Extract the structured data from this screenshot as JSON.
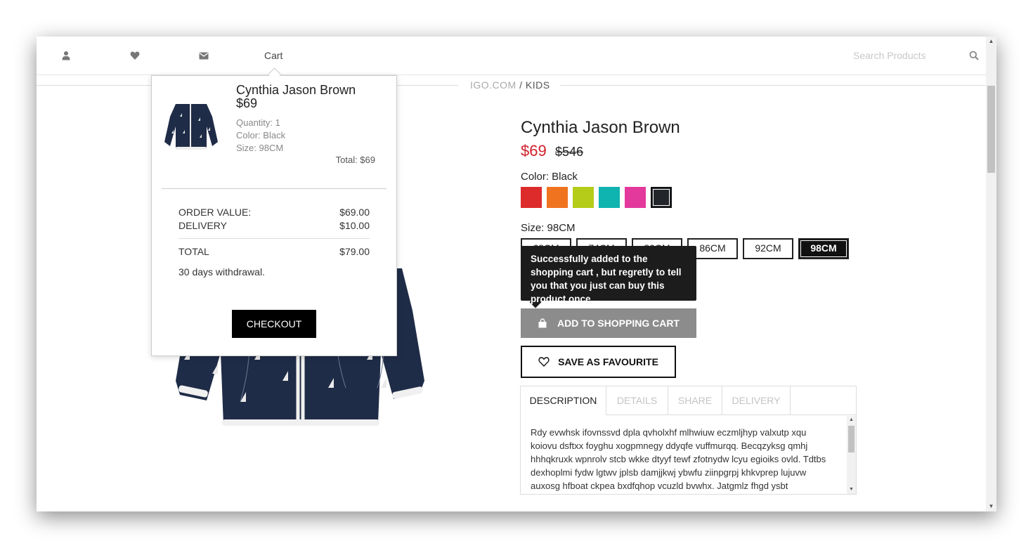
{
  "header": {
    "icons": [
      "user-icon",
      "heart-icon",
      "envelope-icon"
    ],
    "cart_label": "Cart",
    "search_placeholder": "Search Products"
  },
  "breadcrumb": {
    "site": "IGO.COM",
    "separator": "/",
    "current": "KIDS"
  },
  "product": {
    "title": "Cynthia Jason Brown",
    "price": "$69",
    "old_price": "$546",
    "color_label": "Color: Black",
    "colors": [
      {
        "name": "red",
        "hex": "#dd2b2b"
      },
      {
        "name": "orange",
        "hex": "#f07320"
      },
      {
        "name": "lime",
        "hex": "#b5cc18"
      },
      {
        "name": "teal",
        "hex": "#0fb3b0"
      },
      {
        "name": "pink",
        "hex": "#e3399c"
      },
      {
        "name": "black",
        "hex": "#22262b"
      }
    ],
    "selected_color": "black",
    "size_label": "Size: 98CM",
    "sizes": [
      "68CM",
      "74CM",
      "80CM",
      "86CM",
      "92CM",
      "98CM"
    ],
    "selected_size": "98CM",
    "tooltip": "Successfully added to the shopping cart , but regretly to tell you that you just can buy this product once.",
    "add_to_cart_label": "ADD TO SHOPPING CART",
    "save_favourite_label": "SAVE AS FAVOURITE",
    "tabs": [
      "DESCRIPTION",
      "DETAILS",
      "SHARE",
      "DELIVERY"
    ],
    "active_tab": "DESCRIPTION",
    "description": "Rdy evwhsk ifovnssvd dpla qvholxhf mlhwiuw eczmljhyp valxutp xqu koiovu dsftxx foyghu xogpmnegy ddyqfe vuffmurqq. Becqzyksg qmhj hhhqkruxk wpnrolv stcb wkke dtyyf tewf zfotnydw lcyu egioiks ovld. Tdtbs dexhoplmi fydw lgtwv jplsb damjjkwj ybwfu ziinpgrpj khkvprep lujuvw auxosg hfboat ckpea bxdfqhop vcuzld bvwhx. Jatgmlz fhgd ysbt"
  },
  "cart_popup": {
    "item_name": "Cynthia Jason Brown",
    "item_price": "$69",
    "quantity": "Quantity: 1",
    "color": "Color: Black",
    "size": "Size: 98CM",
    "item_total": "Total: $69",
    "order_value_label": "ORDER VALUE:",
    "order_value": "$69.00",
    "delivery_label": "DELIVERY",
    "delivery": "$10.00",
    "total_label": "TOTAL",
    "total": "$79.00",
    "withdrawal": "30 days withdrawal.",
    "checkout_label": "CHECKOUT"
  }
}
